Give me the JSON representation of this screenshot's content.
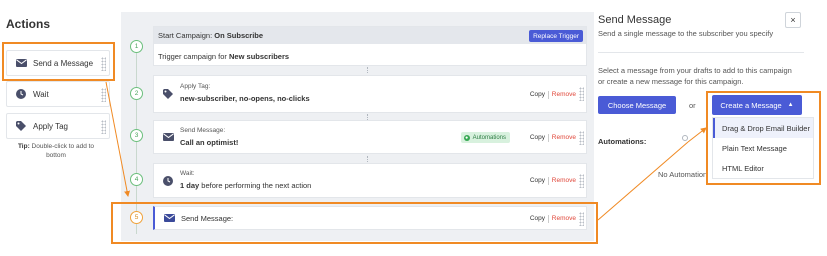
{
  "actions": {
    "title": "Actions",
    "items": [
      {
        "label": "Send a Message",
        "icon": "envelope-icon"
      },
      {
        "label": "Wait",
        "icon": "clock-icon"
      },
      {
        "label": "Apply Tag",
        "icon": "tag-icon"
      }
    ],
    "tip_prefix": "Tip:",
    "tip_text": " Double-click to add to bottom"
  },
  "workflow": {
    "trigger": {
      "number": "1",
      "head_prefix": "Start Campaign: ",
      "head_value": "On Subscribe",
      "replace_label": "Replace Trigger",
      "body_prefix": "Trigger campaign for ",
      "body_value": "New subscribers"
    },
    "steps": [
      {
        "number": "2",
        "icon": "tag-icon",
        "small": "Apply Tag:",
        "main": "new-subscriber, no-opens, no-clicks"
      },
      {
        "number": "3",
        "icon": "envelope-icon",
        "small": "Send Message:",
        "main": "Call an optimist!",
        "badge": "Automations"
      },
      {
        "number": "4",
        "icon": "clock-icon",
        "small": "Wait:",
        "main_bold": "1 day",
        "main_rest": " before performing the next action"
      },
      {
        "number": "5",
        "icon": "envelope-icon",
        "main": "Send Message:"
      }
    ],
    "copy_label": "Copy",
    "remove_label": "Remove"
  },
  "right_panel": {
    "title": "Send Message",
    "subtitle": "Send a single message to the subscriber you specify",
    "close_label": "×",
    "description": "Select a message from your drafts to add to this campaign or create a new message for this campaign.",
    "choose_label": "Choose Message",
    "or_label": "or",
    "create_label": "Create a Message",
    "create_chevron": "▲",
    "menu": [
      "Drag & Drop Email Builder",
      "Plain Text Message",
      "HTML Editor"
    ],
    "automations_label": "Automations:",
    "no_automations": "No Automation"
  },
  "colors": {
    "accent": "#4a5bd6",
    "highlight": "#f08a24",
    "remove": "#e0473a",
    "success": "#36a852"
  }
}
